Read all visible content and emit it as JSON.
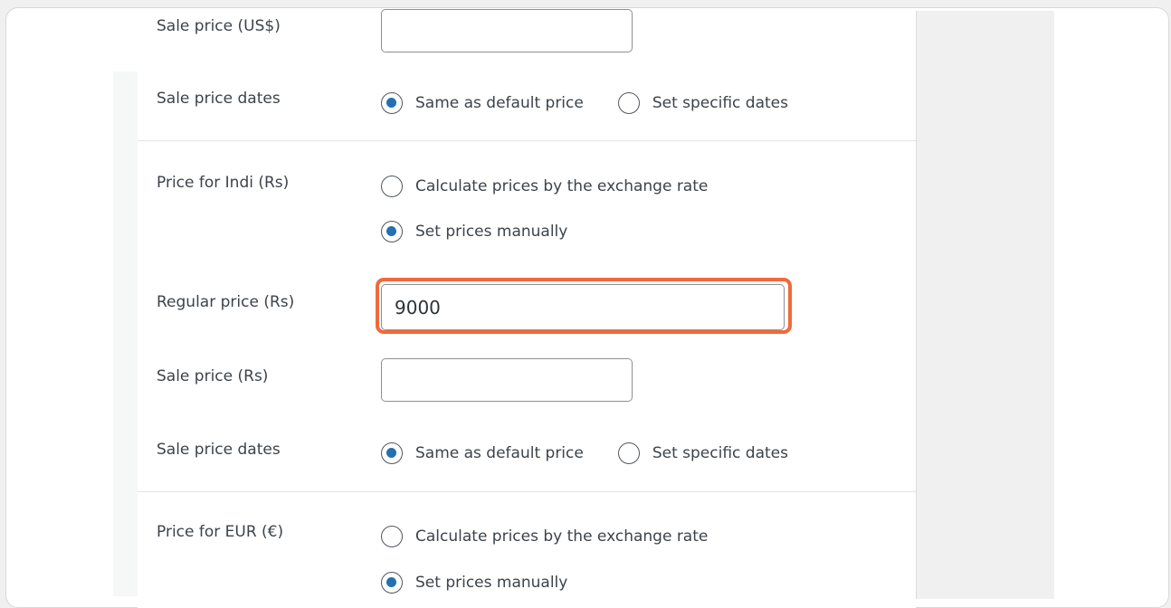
{
  "colors": {
    "accent": "#2271b1",
    "highlight": "#f06a3b"
  },
  "usd": {
    "sale_price_label": "Sale price (US$)",
    "sale_price_value": "",
    "sale_dates_label": "Sale price dates",
    "sale_dates_options": [
      "Same as default price",
      "Set specific dates"
    ],
    "sale_dates_selected": 0
  },
  "indi": {
    "price_label": "Price for Indi (Rs)",
    "price_options": [
      "Calculate prices by the exchange rate",
      "Set prices manually"
    ],
    "price_selected": 1,
    "regular_price_label": "Regular price (Rs)",
    "regular_price_value": "9000",
    "sale_price_label": "Sale price (Rs)",
    "sale_price_value": "",
    "sale_dates_label": "Sale price dates",
    "sale_dates_options": [
      "Same as default price",
      "Set specific dates"
    ],
    "sale_dates_selected": 0
  },
  "eur": {
    "price_label": "Price for EUR (€)",
    "price_options": [
      "Calculate prices by the exchange rate",
      "Set prices manually"
    ],
    "price_selected": 1
  }
}
